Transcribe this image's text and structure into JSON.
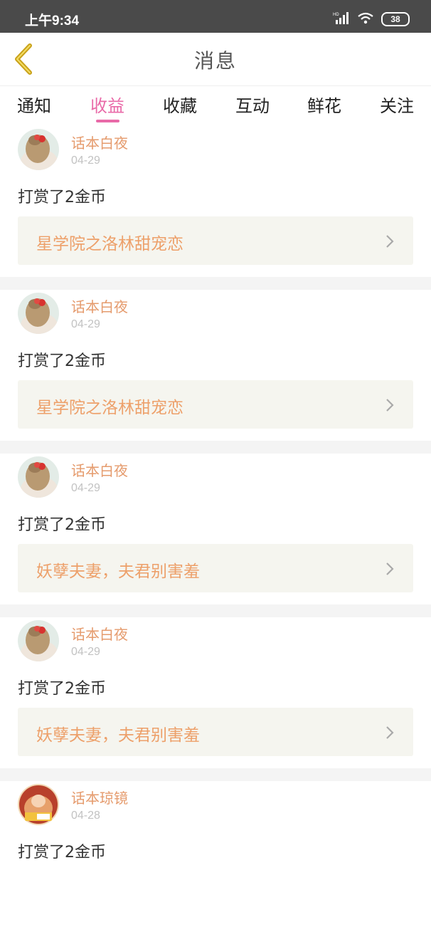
{
  "status_bar": {
    "time": "上午9:34",
    "battery": "38",
    "network": "HD"
  },
  "header": {
    "title": "消息"
  },
  "tabs": [
    {
      "label": "通知"
    },
    {
      "label": "收益",
      "active": true
    },
    {
      "label": "收藏"
    },
    {
      "label": "互动"
    },
    {
      "label": "鲜花"
    },
    {
      "label": "关注"
    }
  ],
  "feed": [
    {
      "user": "话本白夜",
      "date": "04-29",
      "message": "打赏了2金币",
      "book": "星学院之洛林甜宠恋"
    },
    {
      "user": "话本白夜",
      "date": "04-29",
      "message": "打赏了2金币",
      "book": "星学院之洛林甜宠恋"
    },
    {
      "user": "话本白夜",
      "date": "04-29",
      "message": "打赏了2金币",
      "book": "妖孽夫妻，夫君别害羞"
    },
    {
      "user": "话本白夜",
      "date": "04-29",
      "message": "打赏了2金币",
      "book": "妖孽夫妻，夫君别害羞"
    },
    {
      "user": "话本琼镜",
      "date": "04-28",
      "message": "打赏了2金币"
    }
  ],
  "colors": {
    "accent": "#e96aa8",
    "username": "#e59b6d",
    "book_title": "#eda06a",
    "book_bg": "#f5f5ef"
  }
}
